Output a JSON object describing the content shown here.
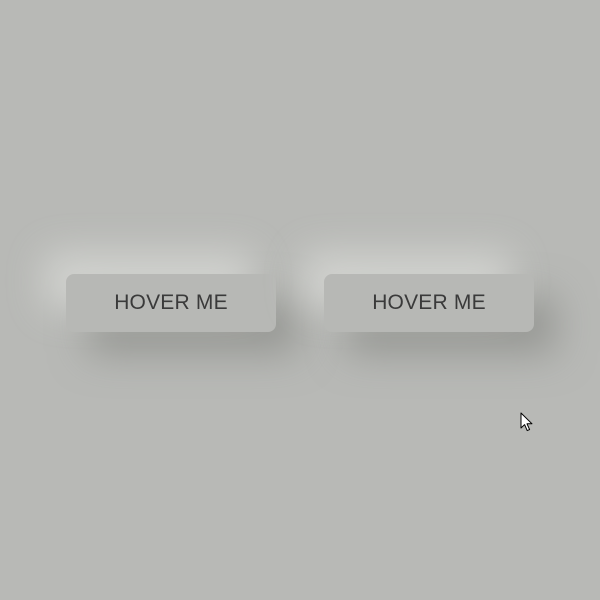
{
  "page": {
    "background_color": "#b8b9b6"
  },
  "buttons": [
    {
      "label": "HOVER ME"
    },
    {
      "label": "HOVER ME"
    }
  ],
  "cursor": {
    "icon": "arrow-pointer-icon"
  }
}
